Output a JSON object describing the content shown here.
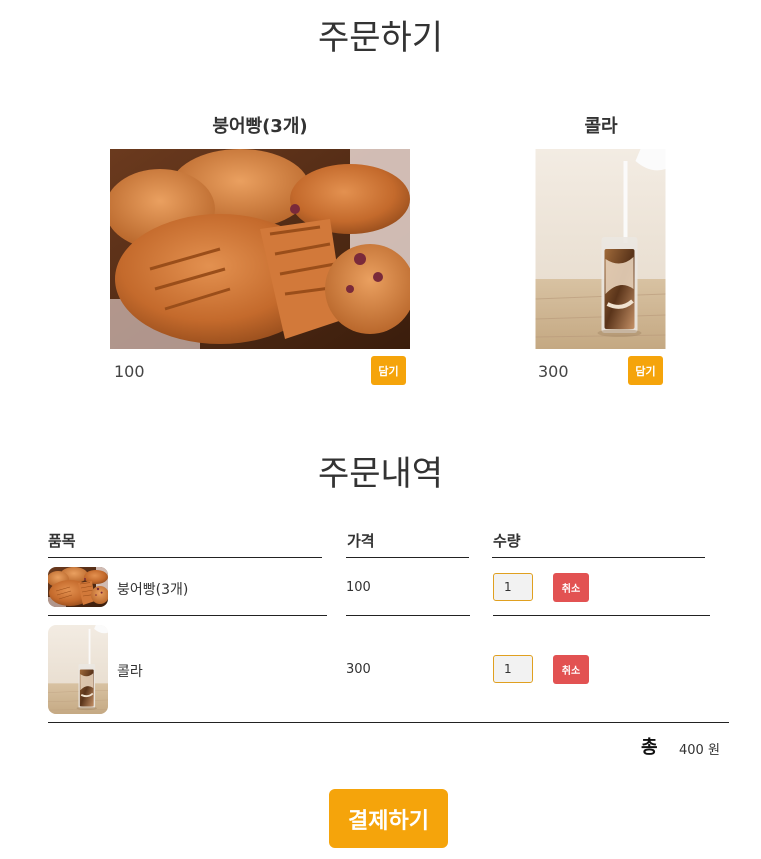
{
  "page": {
    "title": "주문하기",
    "order_title": "주문내역"
  },
  "products": [
    {
      "name": "붕어빵(3개)",
      "price": "100",
      "add_label": "담기",
      "image": "bungeoppang-photo"
    },
    {
      "name": "콜라",
      "price": "300",
      "add_label": "담기",
      "image": "iced-latte-photo"
    }
  ],
  "order": {
    "headers": {
      "item": "품목",
      "price": "가격",
      "quantity": "수량"
    },
    "rows": [
      {
        "name": "붕어빵(3개)",
        "price": "100",
        "quantity": "1",
        "cancel_label": "취소",
        "image": "bungeoppang-photo"
      },
      {
        "name": "콜라",
        "price": "300",
        "quantity": "1",
        "cancel_label": "취소",
        "image": "iced-latte-photo"
      }
    ],
    "total_label": "총",
    "total_value": "400 원"
  },
  "checkout": {
    "pay_label": "결제하기"
  },
  "colors": {
    "accent": "#f5a40b",
    "cancel": "#e25252",
    "text": "#333333"
  }
}
